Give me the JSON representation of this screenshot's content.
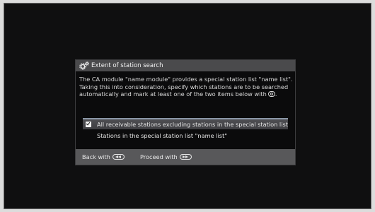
{
  "dialog": {
    "title": "Extent of station search",
    "title_icon": "gear-icon",
    "description": {
      "line1": "The CA module \"name module\" provides a special station list \"name list\".",
      "line2": "Taking this into consideration, specify which stations are to be searched",
      "line3": "automatically and mark at least one of the two items below with",
      "line3_end": "."
    },
    "options": [
      {
        "label": "All receivable stations excluding stations in the special station list",
        "checked": true,
        "selected": true
      },
      {
        "label": "Stations in the special station list \"name list\"",
        "checked": false,
        "selected": false
      }
    ],
    "footer": {
      "back_label": "Back with",
      "back_icon": "rewind-button-icon",
      "proceed_label": "Proceed with",
      "proceed_icon": "fast-forward-button-icon"
    }
  },
  "colors": {
    "screen_background": "#0f0f10",
    "dialog_frame": "#58585a",
    "selection_highlight": "#8a96a6"
  }
}
